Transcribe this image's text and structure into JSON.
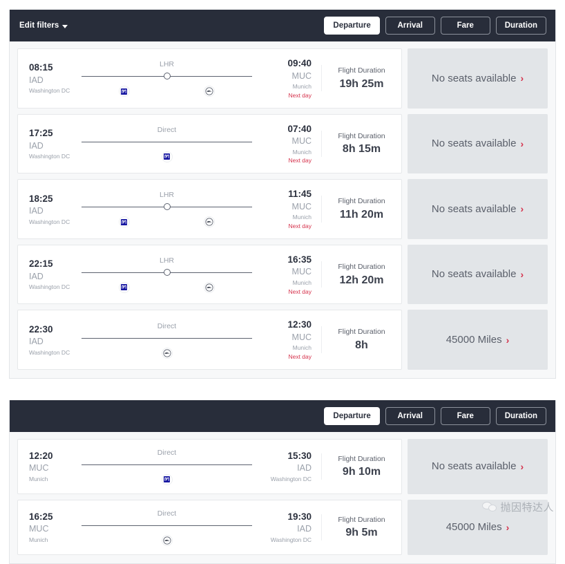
{
  "colors": {
    "header_bg": "#282d3a",
    "accent_red": "#d5314b",
    "cta_bg": "#e2e5e8",
    "muted_text": "#9aa0aa"
  },
  "cards": [
    {
      "header": {
        "edit_filters_label": "Edit filters",
        "show_edit_filters": true,
        "sort_buttons": [
          {
            "label": "Departure",
            "active": true
          },
          {
            "label": "Arrival",
            "active": false
          },
          {
            "label": "Fare",
            "active": false
          },
          {
            "label": "Duration",
            "active": false
          }
        ]
      },
      "flights": [
        {
          "depart": {
            "time": "08:15",
            "code": "IAD",
            "city": "Washington DC",
            "next_day": ""
          },
          "arrive": {
            "time": "09:40",
            "code": "MUC",
            "city": "Munich",
            "next_day": "Next day"
          },
          "route_label": "LHR",
          "stop": true,
          "logos": [
            "united",
            "lufthansa"
          ],
          "duration_label": "Flight Duration",
          "duration_value": "19h 25m",
          "cta_text": "No seats available"
        },
        {
          "depart": {
            "time": "17:25",
            "code": "IAD",
            "city": "Washington DC",
            "next_day": ""
          },
          "arrive": {
            "time": "07:40",
            "code": "MUC",
            "city": "Munich",
            "next_day": "Next day"
          },
          "route_label": "Direct",
          "stop": false,
          "logos": [
            "united"
          ],
          "duration_label": "Flight Duration",
          "duration_value": "8h 15m",
          "cta_text": "No seats available"
        },
        {
          "depart": {
            "time": "18:25",
            "code": "IAD",
            "city": "Washington DC",
            "next_day": ""
          },
          "arrive": {
            "time": "11:45",
            "code": "MUC",
            "city": "Munich",
            "next_day": "Next day"
          },
          "route_label": "LHR",
          "stop": true,
          "logos": [
            "united",
            "lufthansa"
          ],
          "duration_label": "Flight Duration",
          "duration_value": "11h 20m",
          "cta_text": "No seats available"
        },
        {
          "depart": {
            "time": "22:15",
            "code": "IAD",
            "city": "Washington DC",
            "next_day": ""
          },
          "arrive": {
            "time": "16:35",
            "code": "MUC",
            "city": "Munich",
            "next_day": "Next day"
          },
          "route_label": "LHR",
          "stop": true,
          "logos": [
            "united",
            "lufthansa"
          ],
          "duration_label": "Flight Duration",
          "duration_value": "12h 20m",
          "cta_text": "No seats available"
        },
        {
          "depart": {
            "time": "22:30",
            "code": "IAD",
            "city": "Washington DC",
            "next_day": ""
          },
          "arrive": {
            "time": "12:30",
            "code": "MUC",
            "city": "Munich",
            "next_day": "Next day"
          },
          "route_label": "Direct",
          "stop": false,
          "logos": [
            "lufthansa"
          ],
          "duration_label": "Flight Duration",
          "duration_value": "8h",
          "cta_text": "45000 Miles"
        }
      ]
    },
    {
      "header": {
        "edit_filters_label": "",
        "show_edit_filters": false,
        "sort_buttons": [
          {
            "label": "Departure",
            "active": true
          },
          {
            "label": "Arrival",
            "active": false
          },
          {
            "label": "Fare",
            "active": false
          },
          {
            "label": "Duration",
            "active": false
          }
        ]
      },
      "flights": [
        {
          "depart": {
            "time": "12:20",
            "code": "MUC",
            "city": "Munich",
            "next_day": ""
          },
          "arrive": {
            "time": "15:30",
            "code": "IAD",
            "city": "Washington DC",
            "next_day": ""
          },
          "route_label": "Direct",
          "stop": false,
          "logos": [
            "united"
          ],
          "duration_label": "Flight Duration",
          "duration_value": "9h 10m",
          "cta_text": "No seats available"
        },
        {
          "depart": {
            "time": "16:25",
            "code": "MUC",
            "city": "Munich",
            "next_day": ""
          },
          "arrive": {
            "time": "19:30",
            "code": "IAD",
            "city": "Washington DC",
            "next_day": ""
          },
          "route_label": "Direct",
          "stop": false,
          "logos": [
            "lufthansa"
          ],
          "duration_label": "Flight Duration",
          "duration_value": "9h 5m",
          "cta_text": "45000 Miles"
        }
      ]
    }
  ],
  "watermark": {
    "text": "抛因特达人"
  }
}
